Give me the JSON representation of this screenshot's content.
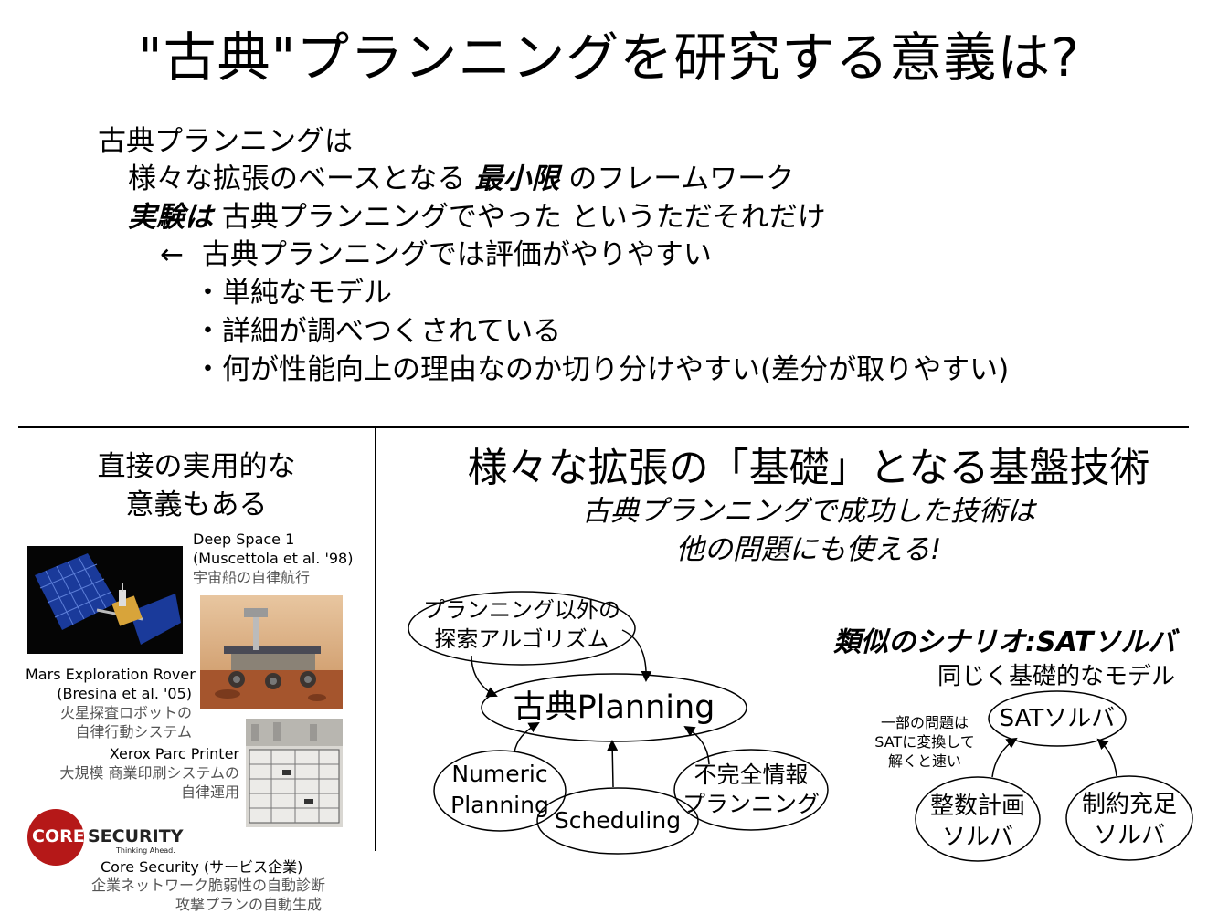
{
  "title": "\"古典\"プランニングを研究する意義は?",
  "bullets": {
    "line1": "古典プランニングは",
    "line2_pre": "様々な拡張のベースとなる ",
    "line2_em": "最小限",
    "line2_post": " のフレームワーク",
    "line3_em": "実験は",
    "line3_post": " 古典プランニングでやった というただそれだけ",
    "line4_arrow": "←",
    "line4": "古典プランニングでは評価がやりやすい",
    "sub1": "・単純なモデル",
    "sub2": "・詳細が調べつくされている",
    "sub3": "・何が性能向上の理由なのか切り分けやすい(差分が取りやすい)"
  },
  "left": {
    "heading_l1": "直接の実用的な",
    "heading_l2": "意義もある",
    "ds1_title": "Deep Space 1",
    "ds1_ref": "(Muscettola et al. '98)",
    "ds1_jp": "宇宙船の自律航行",
    "mer_title": "Mars Exploration Rover",
    "mer_ref": "(Bresina et al. '05)",
    "mer_jp1": "火星探査ロボットの",
    "mer_jp2": "自律行動システム",
    "xerox_title": "Xerox  Parc Printer",
    "xerox_jp1": "大規模 商業印刷システムの",
    "xerox_jp2": "自律運用",
    "core_logo_a": "CORE",
    "core_logo_b": "SECURITY",
    "core_logo_tag": "Thinking Ahead.",
    "core_title": "Core Security (サービス企業)",
    "core_jp1": "企業ネットワーク脆弱性の自動診断",
    "core_jp2": "攻撃プランの自動生成"
  },
  "middle": {
    "heading": "様々な拡張の「基礎」となる基盤技術",
    "sub_l1": "古典プランニングで成功した技術は",
    "sub_l2": "他の問題にも使える!",
    "node_search_l1": "プランニング以外の",
    "node_search_l2": "探索アルゴリズム",
    "node_center": "古典Planning",
    "node_numeric_l1": "Numeric",
    "node_numeric_l2": "Planning",
    "node_sched": "Scheduling",
    "node_incomplete_l1": "不完全情報",
    "node_incomplete_l2": "プランニング"
  },
  "right": {
    "heading": "類似のシナリオ:SATソルバ",
    "sub": "同じく基礎的なモデル",
    "note_l1": "一部の問題は",
    "note_l2": "SATに変換して",
    "note_l3": "解くと速い",
    "node_sat": "SATソルバ",
    "node_int_l1": "整数計画",
    "node_int_l2": "ソルバ",
    "node_csp_l1": "制約充足",
    "node_csp_l2": "ソルバ"
  }
}
